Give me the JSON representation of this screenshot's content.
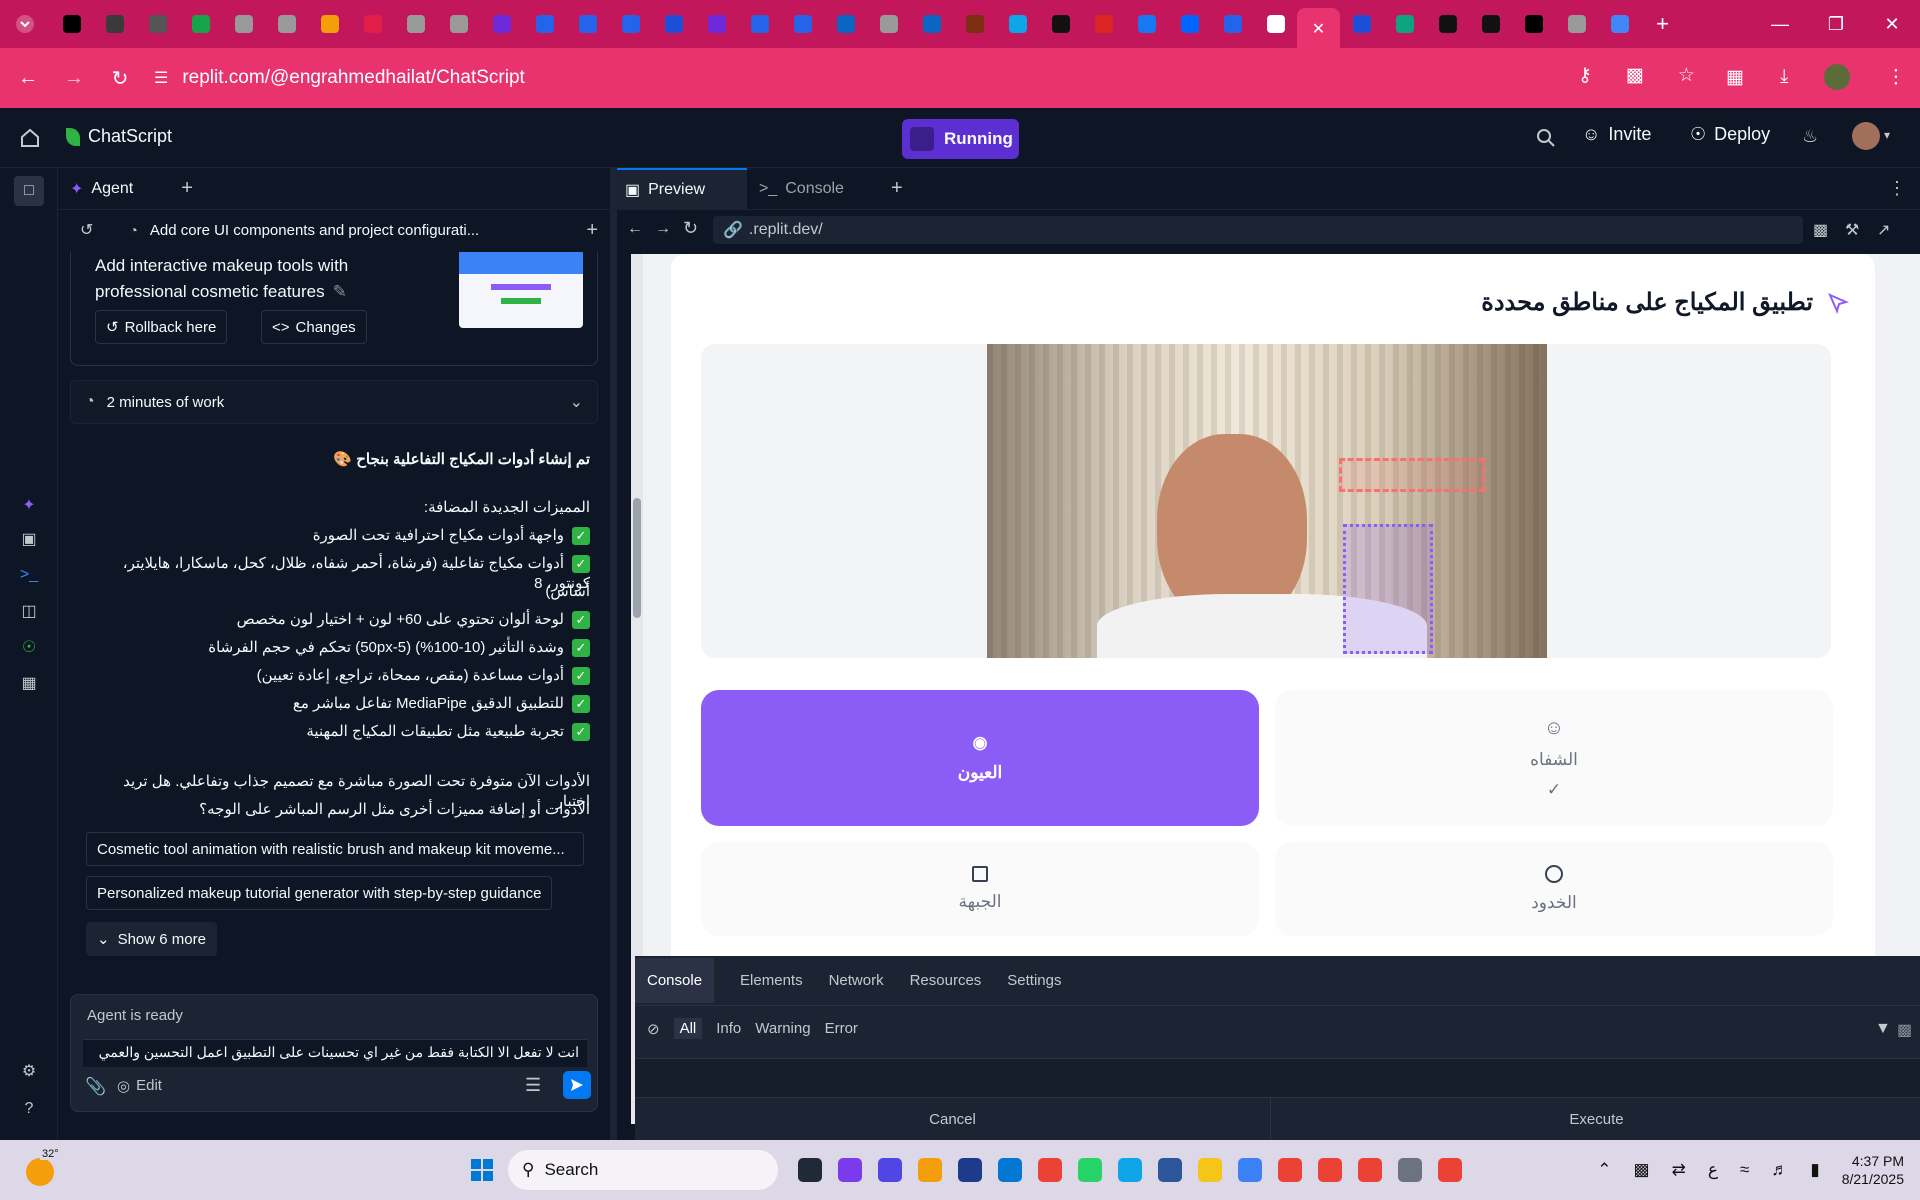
{
  "browser": {
    "url": "replit.com/@engrahmedhailat/ChatScript",
    "tab_colors": [
      "#000000",
      "#3a3a3a",
      "#555555",
      "#16a34a",
      "#999999",
      "#999999",
      "#f59e0b",
      "#e11d48",
      "#999999",
      "#999999",
      "#6d28d9",
      "#2563eb",
      "#2563eb",
      "#2563eb",
      "#1d4ed8",
      "#6d28d9",
      "#2563eb",
      "#2563eb",
      "#0a66c2",
      "#999999",
      "#0a66c2",
      "#7c2d12",
      "#0ea5e9",
      "#111111",
      "#dc2626",
      "#1877f2",
      "#0066ff",
      "#2563eb",
      "#ffffff",
      "#e8336f",
      "#1d4ed8",
      "#10a37f",
      "#111111",
      "#111111",
      "#000000",
      "#999999",
      "#4285f4"
    ]
  },
  "header": {
    "home_icon": "home-icon",
    "project_name": "ChatScript",
    "run_status": "Running",
    "invite": "Invite",
    "deploy": "Deploy"
  },
  "agent": {
    "tab_label": "Agent",
    "checkpoint_title": "Add core UI components and project configurati...",
    "card_text_line1": "Add interactive makeup tools with",
    "card_text_line2": "professional cosmetic features",
    "rollback": "Rollback here",
    "changes": "Changes",
    "work_time": "2 minutes of work",
    "msg_title": "تم إنشاء أدوات المكياج التفاعلية بنجاح 🎨",
    "features_heading": "المميزات الجديدة المضافة:",
    "features": [
      "واجهة أدوات مكياج احترافية تحت الصورة",
      "أدوات مكياج تفاعلية (فرشاة، أحمر شفاه، ظلال، كحل، ماسكارا، هايلايتر، كونتور، 8",
      "أساس)",
      "لوحة ألوان تحتوي على 60+ لون + اختيار لون مخصص",
      "وشدة التأثير (10-100%) (5-50px) تحكم في حجم الفرشاة",
      "أدوات مساعدة (مقص، ممحاة، تراجع، إعادة تعيين)",
      "للتطبيق الدقيق MediaPipe تفاعل مباشر مع",
      "تجربة طبيعية مثل تطبيقات المكياج المهنية"
    ],
    "closing_line1": "الأدوات الآن متوفرة تحت الصورة مباشرة مع تصميم جذاب وتفاعلي. هل تريد اختبار",
    "closing_line2": "الأدوات أو إضافة مميزات أخرى مثل الرسم المباشر على الوجه؟",
    "suggestion1": "Cosmetic tool animation with realistic brush and makeup kit moveme...",
    "suggestion2": "Personalized makeup tutorial generator with step-by-step guidance",
    "show_more": "Show 6 more",
    "status": "Agent is ready",
    "input_text": "انت لا تفعل الا الكتابة فقط من غير اي تحسينات على التطبيق اعمل التحسين والعمي",
    "edit": "Edit"
  },
  "workspace": {
    "tab_preview": "Preview",
    "tab_console": "Console",
    "preview_url": ".replit.dev/"
  },
  "app": {
    "title": "تطبيق المكياج على مناطق محددة",
    "areas": [
      {
        "label": "العيون",
        "selected": true
      },
      {
        "label": "الشفاه",
        "selected": false,
        "checked": true
      },
      {
        "label": "الجبهة",
        "selected": false
      },
      {
        "label": "الخدود",
        "selected": false
      }
    ],
    "accent": "#8b5cf6"
  },
  "devtools": {
    "tabs": [
      "Console",
      "Elements",
      "Network",
      "Resources",
      "Settings"
    ],
    "filters": [
      "All",
      "Info",
      "Warning",
      "Error"
    ],
    "cancel": "Cancel",
    "execute": "Execute"
  },
  "taskbar": {
    "weather": "32°",
    "search": "Search",
    "lang": "ع",
    "time": "4:37 PM",
    "date": "8/21/2025"
  }
}
